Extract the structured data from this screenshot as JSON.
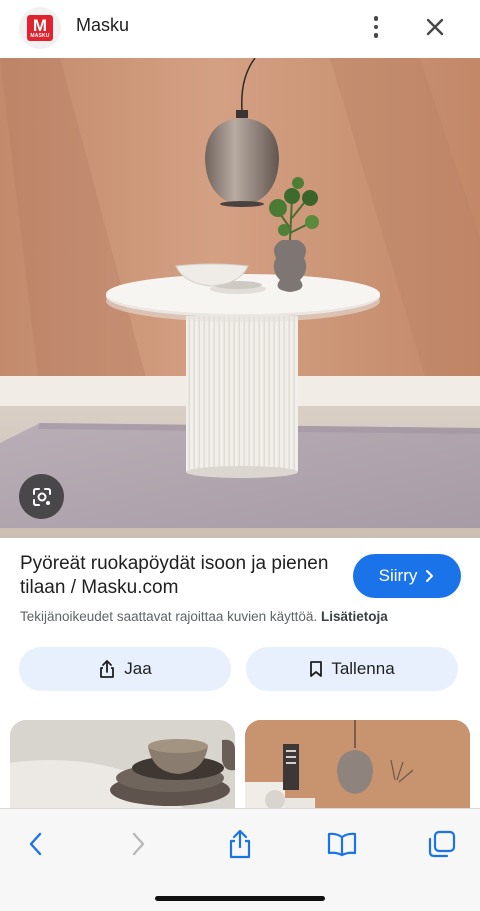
{
  "header": {
    "logo_icon": "masku-logo",
    "logo_letter": "M",
    "logo_word": "MASKU",
    "site_name": "Masku",
    "more_icon": "vertical-dots-icon",
    "close_icon": "close-icon"
  },
  "hero": {
    "image_icon": "product-photo",
    "lens_icon": "google-lens-icon"
  },
  "result": {
    "title": "Pyöreät ruokapöydät isoon ja pienen tilaan / Masku.com",
    "visit_label": "Siirry",
    "copyright_text": "Tekijänoikeudet saattavat rajoittaa kuvien käyttöä.",
    "more_info_label": "Lisätietoja"
  },
  "actions": {
    "share_label": "Jaa",
    "save_label": "Tallenna"
  },
  "colors": {
    "brand_red": "#e0232f",
    "accent_blue": "#1a73e8",
    "chip_bg": "#e8f0fe",
    "toolbar_blue": "#1a73e8"
  },
  "toolbar": {
    "items": [
      "back-icon",
      "forward-icon",
      "share-icon",
      "bookmarks-icon",
      "tabs-icon"
    ]
  }
}
